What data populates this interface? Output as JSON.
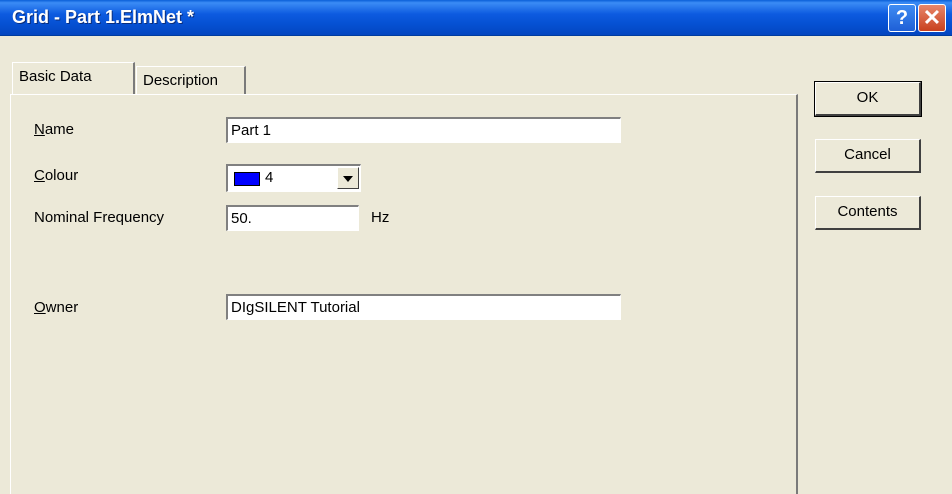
{
  "window": {
    "title": "Grid - Part 1.ElmNet *",
    "help_glyph": "?",
    "close_glyph": "✕"
  },
  "tabs": [
    {
      "label": "Basic Data",
      "active": true
    },
    {
      "label": "Description",
      "active": false
    }
  ],
  "form": {
    "name": {
      "accel": "N",
      "rest": "ame",
      "value": "Part 1"
    },
    "colour": {
      "accel": "C",
      "rest": "olour",
      "value": "4",
      "swatch_color": "#0000ff"
    },
    "nominal_frequency": {
      "label": "Nominal Frequency",
      "value": "50.",
      "unit": "Hz"
    },
    "owner": {
      "accel": "O",
      "rest": "wner",
      "value": "DIgSILENT Tutorial"
    }
  },
  "buttons": {
    "ok": "OK",
    "cancel": "Cancel",
    "contents": "Contents"
  },
  "colors": {
    "titlebar": "#0550d2",
    "dialog_bg": "#ece9d8"
  }
}
